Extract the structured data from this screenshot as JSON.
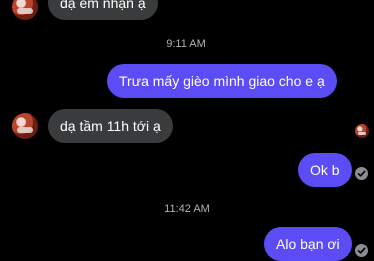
{
  "messages": [
    {
      "side": "in",
      "text": "dạ em nhận ạ"
    },
    {
      "side": "out",
      "text": "Trưa mấy gièo mình giao cho e ạ"
    },
    {
      "side": "in",
      "text": "dạ tầm 11h tới ạ"
    },
    {
      "side": "out",
      "text": "Ok b"
    },
    {
      "side": "out",
      "text": "Alo bạn ơi"
    }
  ],
  "timestamps": [
    "9:11 AM",
    "11:42 AM"
  ],
  "icons": {
    "avatar": "contact-avatar",
    "seen": "check-circle-icon"
  }
}
